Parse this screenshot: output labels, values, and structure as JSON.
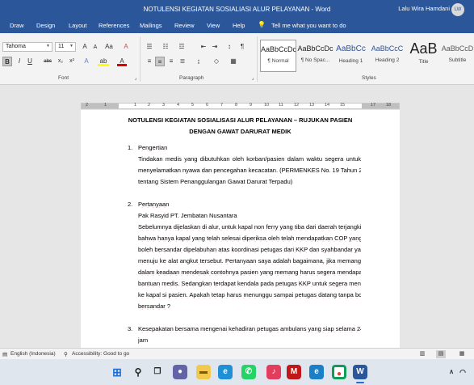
{
  "window": {
    "title": "NOTULENSI KEGIATAN SOSIALIASI ALUR PELAYANAN  -  Word",
    "user_name": "Lalu Wira Hamdani",
    "user_initials": "LW"
  },
  "ribbon_tabs": [
    "Draw",
    "Design",
    "Layout",
    "References",
    "Mailings",
    "Review",
    "View",
    "Help",
    "Tell me what you want to do"
  ],
  "font_group": {
    "font_name": "Tahoma",
    "font_size": "11",
    "grow": "A",
    "shrink": "A",
    "case": "Aa",
    "clear": "A",
    "bold": "B",
    "italic": "I",
    "underline": "U",
    "strike": "abc",
    "subscript": "x₂",
    "superscript": "x²",
    "effects": "A",
    "highlight": "ab",
    "font_color": "A",
    "label": "Font"
  },
  "paragraph_group": {
    "label": "Paragraph",
    "show_marks": "¶"
  },
  "styles_group": {
    "label": "Styles",
    "items": [
      {
        "sample": "AaBbCcDc",
        "name": "¶ Normal"
      },
      {
        "sample": "AaBbCcDc",
        "name": "¶ No Spac..."
      },
      {
        "sample": "AaBbCc",
        "name": "Heading 1"
      },
      {
        "sample": "AaBbCcC",
        "name": "Heading 2"
      },
      {
        "sample": "AaB",
        "name": "Title"
      },
      {
        "sample": "AaBbCcD",
        "name": "Subtitle"
      }
    ]
  },
  "ruler": {
    "numbers": [
      "2",
      "1",
      "1",
      "2",
      "3",
      "4",
      "5",
      "6",
      "7",
      "8",
      "9",
      "10",
      "11",
      "12",
      "13",
      "14",
      "15",
      "17",
      "18"
    ]
  },
  "document": {
    "heading_line1": "NOTULENSI KEGIATAN SOSIALISASI ALUR PELAYANAN – RUJUKAN PASIEN",
    "heading_line2": "DENGAN GAWAT DARURAT MEDIK",
    "section1": {
      "num": "1.",
      "title": "Pengertian",
      "lines": [
        "Tindakan medis yang dibutuhkan oleh korban/pasien dalam waktu segera untuk",
        "menyelamatkan nyawa dan pencegahan kecacatan. (PERMENKES No. 19 Tahun 2016",
        "tentang Sistem Penanggulangan Gawat Darurat Terpadu)"
      ]
    },
    "section2": {
      "num": "2.",
      "title": "Pertanyaan",
      "asker": "Pak Rasyid PT. Jembatan Nusantara",
      "lines": [
        "Sebelumnya dijelaskan di alur, untuk kapal non ferry yang tiba dari daerah terjangkit,",
        "bahwa hanya kapal yang telah selesai diperiksa oleh telah mendapatkan COP yang",
        "boleh bersandar dipelabuhan atas koordinasi petugas dari KKP dan syahbandar yang",
        "menuju ke alat angkut tersebut. Pertanyaan saya adalah bagaimana, jika memang",
        "dalam keadaan mendesak contohnya pasien yang memang harus segera mendapatkan",
        "bantuan medis. Sedangkan terdapat kendala pada petugas KKP untuk segera menuju",
        "ke kapal si pasien. Apakah tetap harus menunggu sampai petugas datang tanpa boleh",
        "bersandar ?"
      ]
    },
    "section3": {
      "num": "3.",
      "lines": [
        "Kesepakatan bersama mengenai kehadiran petugas ambulans yang siap selama 24",
        "jam"
      ]
    }
  },
  "status_bar": {
    "language": "English (Indonesia)",
    "accessibility": "Accessibility: Good to go"
  },
  "taskbar": {
    "icons": [
      "windows-start",
      "search",
      "task-view",
      "chat",
      "file-explorer",
      "edge",
      "whatsapp",
      "music",
      "mcafee",
      "edge-2",
      "chrome",
      "word"
    ]
  },
  "colors": {
    "word_blue": "#2b579a",
    "spell_squiggle": "#d00000"
  }
}
